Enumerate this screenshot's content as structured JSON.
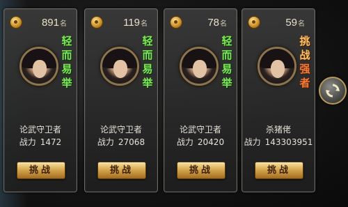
{
  "colors": {
    "accent_gold": "#d7a84f",
    "tag_green": "#7fe85a",
    "tag_orange": "#f9c36a"
  },
  "rank_unit": "名",
  "power_label": "战力",
  "challenge_label": "挑战",
  "cards": [
    {
      "rank": "891",
      "tag": [
        "轻",
        "而",
        "易",
        "举"
      ],
      "tag_color": "green",
      "name": "论武守卫者",
      "power": "1472"
    },
    {
      "rank": "119",
      "tag": [
        "轻",
        "而",
        "易",
        "举"
      ],
      "tag_color": "green",
      "name": "论武守卫者",
      "power": "27068"
    },
    {
      "rank": "78",
      "tag": [
        "轻",
        "而",
        "易",
        "举"
      ],
      "tag_color": "green",
      "name": "论武守卫者",
      "power": "20420"
    },
    {
      "rank": "59",
      "tag": [
        "挑",
        "战",
        "强",
        "者"
      ],
      "tag_color": "orange",
      "name": "杀猪佬",
      "power": "143303951"
    }
  ],
  "icons": {
    "medal": "rank-medal-icon",
    "refresh": "refresh-icon"
  }
}
